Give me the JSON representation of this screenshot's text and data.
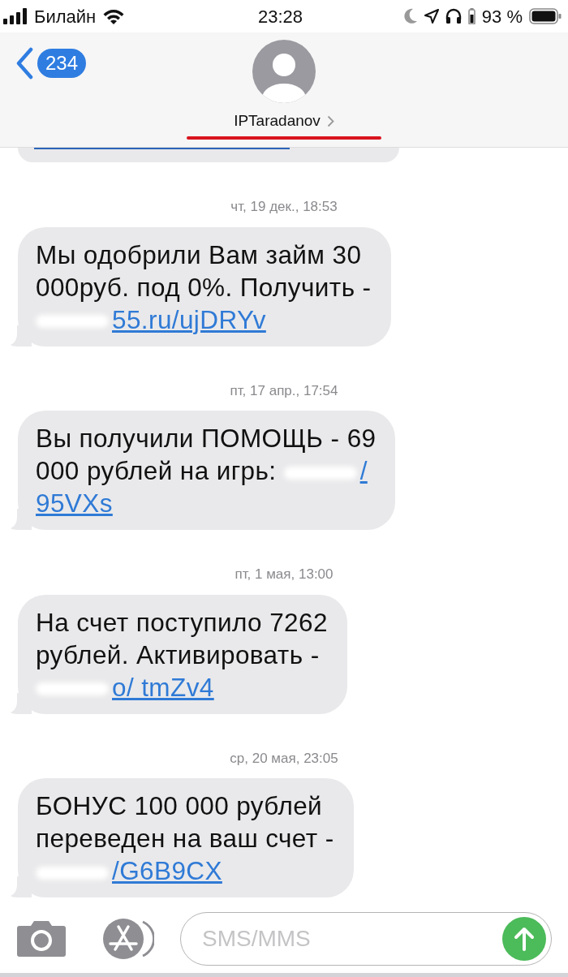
{
  "status_bar": {
    "carrier": "Билайн",
    "time": "23:28",
    "battery": "93 %"
  },
  "header": {
    "back_count": "234",
    "contact": "IPTaradanov"
  },
  "messages": [
    {
      "timestamp": "чт, 19 дек., 18:53",
      "lines": [
        [
          {
            "kind": "text",
            "text": "Мы одобрили Вам займ 30"
          }
        ],
        [
          {
            "kind": "text",
            "text": "000руб. под 0%. Получить -"
          }
        ],
        [
          {
            "kind": "redacted"
          },
          {
            "kind": "link",
            "text": "55.ru/ujDRYv"
          }
        ]
      ]
    },
    {
      "timestamp": "пт, 17 апр., 17:54",
      "lines": [
        [
          {
            "kind": "text",
            "text": "Вы получили ПОМОЩЬ - 69"
          }
        ],
        [
          {
            "kind": "text",
            "text": "000 рублей на игрь:"
          },
          {
            "kind": "redacted"
          },
          {
            "kind": "link",
            "text": "/"
          }
        ],
        [
          {
            "kind": "link",
            "text": "95VXs"
          }
        ]
      ]
    },
    {
      "timestamp": "пт, 1 мая, 13:00",
      "lines": [
        [
          {
            "kind": "text",
            "text": "На счет поступило 7262"
          }
        ],
        [
          {
            "kind": "text",
            "text": "рублей. Активировать -"
          }
        ],
        [
          {
            "kind": "redacted"
          },
          {
            "kind": "link",
            "text": "o/ tmZv4"
          }
        ]
      ]
    },
    {
      "timestamp": "ср, 20 мая, 23:05",
      "lines": [
        [
          {
            "kind": "text",
            "text": "БОНУС 100 000 рублей"
          }
        ],
        [
          {
            "kind": "text",
            "text": "переведен на ваш счет -"
          }
        ],
        [
          {
            "kind": "redacted"
          },
          {
            "kind": "link",
            "text": "/G6B9CX"
          }
        ]
      ]
    }
  ],
  "composer": {
    "placeholder": "SMS/MMS"
  }
}
